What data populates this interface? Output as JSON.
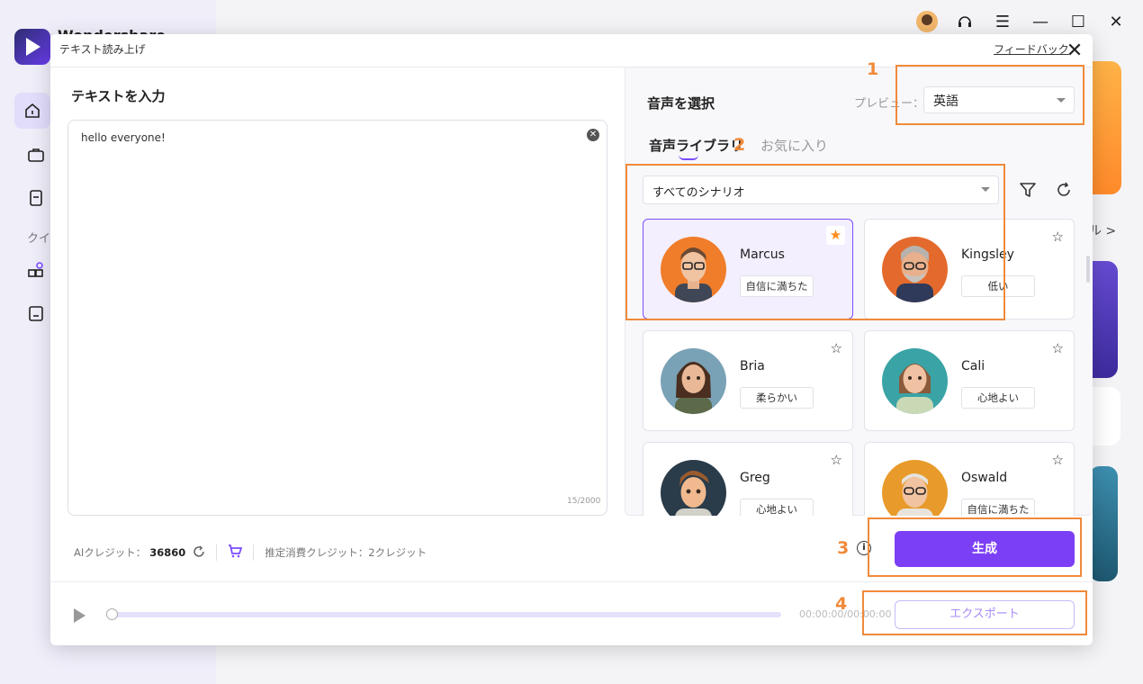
{
  "app": {
    "name": "Wondershare"
  },
  "sidebar": {
    "section_label": "クイ"
  },
  "background": {
    "more_link": "ル >"
  },
  "modal": {
    "title": "テキスト読み上げ",
    "feedback_link": "フィードバック",
    "close_icon": "close-icon"
  },
  "input_panel": {
    "heading": "テキストを入力",
    "text": "hello everyone!",
    "char_count": "15/2000"
  },
  "voice_panel": {
    "heading": "音声を選択",
    "preview_label": "プレビュー：",
    "language_selected": "英語",
    "tabs": [
      {
        "label": "音声ライブラリ",
        "active": true
      },
      {
        "label": "お気に入り",
        "active": false
      }
    ],
    "scenario_selected": "すべてのシナリオ",
    "voices": [
      {
        "name": "Marcus",
        "tag": "自信に満ちた",
        "favorited": true,
        "selected": true
      },
      {
        "name": "Kingsley",
        "tag": "低い",
        "favorited": false,
        "selected": false
      },
      {
        "name": "Bria",
        "tag": "柔らかい",
        "favorited": false,
        "selected": false
      },
      {
        "name": "Cali",
        "tag": "心地よい",
        "favorited": false,
        "selected": false
      },
      {
        "name": "Greg",
        "tag": "心地よい",
        "favorited": false,
        "selected": false
      },
      {
        "name": "Oswald",
        "tag": "自信に満ちた",
        "favorited": false,
        "selected": false
      }
    ]
  },
  "footer": {
    "ai_credit_label": "AIクレジット：",
    "ai_credit_value": "36860",
    "estimated_cost": "推定消費クレジット：2クレジット",
    "generate_label": "生成",
    "export_label": "エクスポート",
    "time": "00:00:00/00:00:00",
    "playback_progress": 0
  },
  "annotations": [
    "1",
    "2",
    "3",
    "4"
  ],
  "colors": {
    "accent": "#7b3ff5",
    "annotation": "#f08a3a",
    "favorite_star": "#ff8c1a"
  }
}
